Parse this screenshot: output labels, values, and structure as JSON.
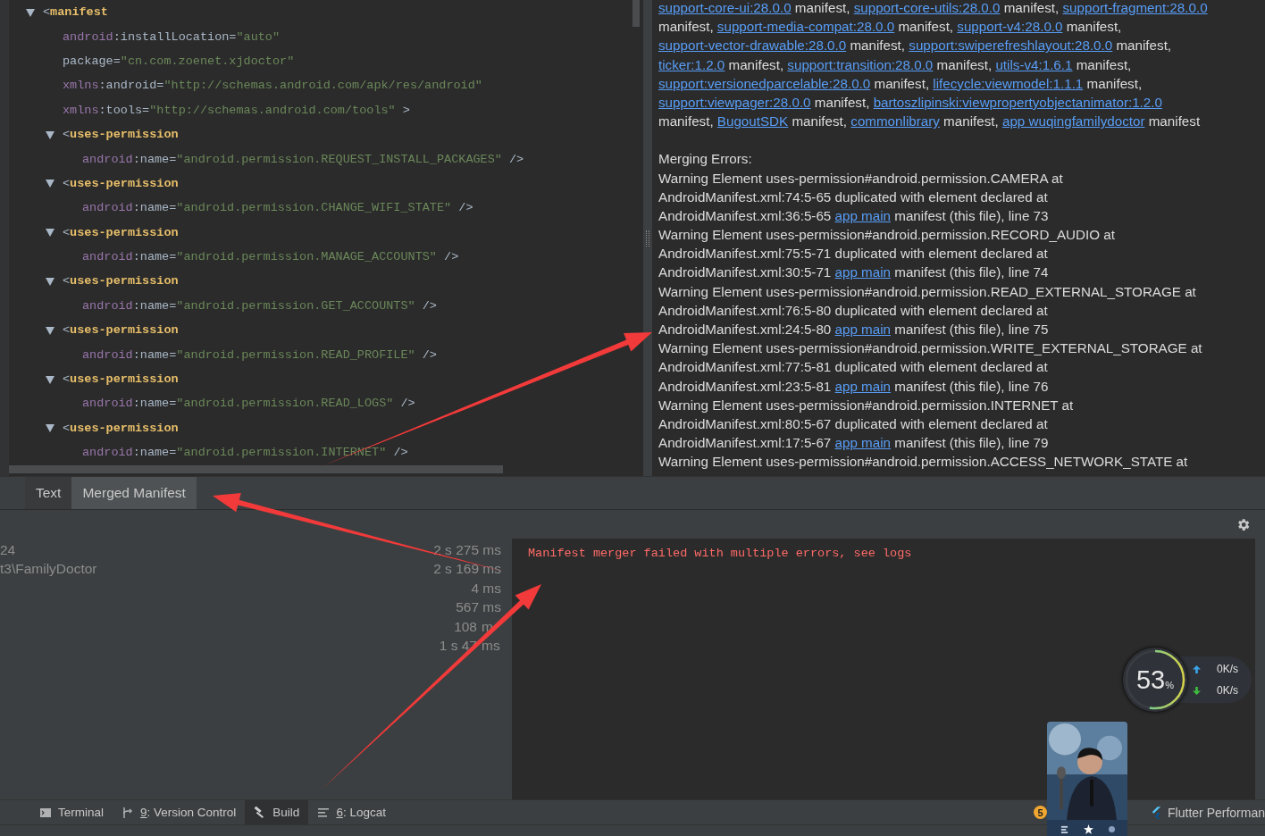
{
  "editor": {
    "nodes": [
      {
        "bracket": "<",
        "tag": "manifest",
        "expanded": true,
        "attributes": [
          {
            "prefix": "android",
            "name": ":installLocation=",
            "value": "\"auto\""
          },
          {
            "name": "package=",
            "value": "\"cn.com.zoenet.xjdoctor\""
          },
          {
            "prefix": "xmlns",
            "name": ":android=",
            "value": "\"http://schemas.android.com/apk/res/android\""
          },
          {
            "prefix": "xmlns",
            "name": ":tools=",
            "value": "\"http://schemas.android.com/tools\"",
            "suffix": " >"
          }
        ],
        "children": [
          {
            "bracket": "<",
            "tag": "uses-permission",
            "expanded": true,
            "attributes": [
              {
                "prefix": "android",
                "name": ":name=",
                "value": "\"android.permission.REQUEST_INSTALL_PACKAGES\"",
                "suffix": " />"
              }
            ]
          },
          {
            "bracket": "<",
            "tag": "uses-permission",
            "expanded": true,
            "attributes": [
              {
                "prefix": "android",
                "name": ":name=",
                "value": "\"android.permission.CHANGE_WIFI_STATE\"",
                "suffix": " />"
              }
            ]
          },
          {
            "bracket": "<",
            "tag": "uses-permission",
            "expanded": true,
            "attributes": [
              {
                "prefix": "android",
                "name": ":name=",
                "value": "\"android.permission.MANAGE_ACCOUNTS\"",
                "suffix": " />"
              }
            ]
          },
          {
            "bracket": "<",
            "tag": "uses-permission",
            "expanded": true,
            "attributes": [
              {
                "prefix": "android",
                "name": ":name=",
                "value": "\"android.permission.GET_ACCOUNTS\"",
                "suffix": " />"
              }
            ]
          },
          {
            "bracket": "<",
            "tag": "uses-permission",
            "expanded": true,
            "attributes": [
              {
                "prefix": "android",
                "name": ":name=",
                "value": "\"android.permission.READ_PROFILE\"",
                "suffix": " />"
              }
            ]
          },
          {
            "bracket": "<",
            "tag": "uses-permission",
            "expanded": true,
            "attributes": [
              {
                "prefix": "android",
                "name": ":name=",
                "value": "\"android.permission.READ_LOGS\"",
                "suffix": " />"
              }
            ]
          },
          {
            "bracket": "<",
            "tag": "uses-permission",
            "expanded": true,
            "attributes": [
              {
                "prefix": "android",
                "name": ":name=",
                "value": "\"android.permission.INTERNET\"",
                "suffix": " />"
              }
            ]
          }
        ]
      }
    ]
  },
  "merged_manifest": {
    "sources": [
      [
        {
          "text": "support-core-ui:28.0.0",
          "kind": "link"
        },
        {
          "text": " manifest, ",
          "kind": "text"
        },
        {
          "text": "support-core-utils:28.0.0",
          "kind": "link"
        },
        {
          "text": " manifest, ",
          "kind": "text"
        },
        {
          "text": "support-fragment:28.0.0",
          "kind": "link"
        }
      ],
      [
        {
          "text": "manifest, ",
          "kind": "text"
        },
        {
          "text": "support-media-compat:28.0.0",
          "kind": "link"
        },
        {
          "text": " manifest, ",
          "kind": "text"
        },
        {
          "text": "support-v4:28.0.0",
          "kind": "link"
        },
        {
          "text": " manifest,",
          "kind": "text"
        }
      ],
      [
        {
          "text": "support-vector-drawable:28.0.0",
          "kind": "link"
        },
        {
          "text": " manifest, ",
          "kind": "text"
        },
        {
          "text": "support:swiperefreshlayout:28.0.0",
          "kind": "link"
        },
        {
          "text": " manifest,",
          "kind": "text"
        }
      ],
      [
        {
          "text": "ticker:1.2.0",
          "kind": "link"
        },
        {
          "text": " manifest, ",
          "kind": "text"
        },
        {
          "text": "support:transition:28.0.0",
          "kind": "link"
        },
        {
          "text": " manifest, ",
          "kind": "text"
        },
        {
          "text": "utils-v4:1.6.1",
          "kind": "link"
        },
        {
          "text": " manifest,",
          "kind": "text"
        }
      ],
      [
        {
          "text": "support:versionedparcelable:28.0.0",
          "kind": "link"
        },
        {
          "text": " manifest, ",
          "kind": "text"
        },
        {
          "text": "lifecycle:viewmodel:1.1.1",
          "kind": "link"
        },
        {
          "text": " manifest,",
          "kind": "text"
        }
      ],
      [
        {
          "text": "support:viewpager:28.0.0",
          "kind": "link"
        },
        {
          "text": " manifest, ",
          "kind": "text"
        },
        {
          "text": "bartoszlipinski:viewpropertyobjectanimator:1.2.0",
          "kind": "link"
        }
      ],
      [
        {
          "text": "manifest, ",
          "kind": "text"
        },
        {
          "text": "BugoutSDK",
          "kind": "link"
        },
        {
          "text": " manifest, ",
          "kind": "text"
        },
        {
          "text": "commonlibrary",
          "kind": "link"
        },
        {
          "text": " manifest, ",
          "kind": "text"
        },
        {
          "text": "app wuqingfamilydoctor",
          "kind": "link"
        },
        {
          "text": " manifest",
          "kind": "text"
        }
      ]
    ],
    "errors_title": "Merging Errors:",
    "errors": [
      [
        {
          "text": "Warning Element uses-permission#android.permission.CAMERA at",
          "kind": "text"
        }
      ],
      [
        {
          "text": "AndroidManifest.xml:74:5-65 duplicated with element declared at",
          "kind": "text"
        }
      ],
      [
        {
          "text": "AndroidManifest.xml:36:5-65 ",
          "kind": "text"
        },
        {
          "text": "app main",
          "kind": "link"
        },
        {
          "text": " manifest (this file), line 73",
          "kind": "text"
        }
      ],
      [
        {
          "text": "Warning Element uses-permission#android.permission.RECORD_AUDIO at",
          "kind": "text"
        }
      ],
      [
        {
          "text": "AndroidManifest.xml:75:5-71 duplicated with element declared at",
          "kind": "text"
        }
      ],
      [
        {
          "text": "AndroidManifest.xml:30:5-71 ",
          "kind": "text"
        },
        {
          "text": "app main",
          "kind": "link"
        },
        {
          "text": " manifest (this file), line 74",
          "kind": "text"
        }
      ],
      [
        {
          "text": "Warning Element uses-permission#android.permission.READ_EXTERNAL_STORAGE at",
          "kind": "text"
        }
      ],
      [
        {
          "text": "AndroidManifest.xml:76:5-80 duplicated with element declared at",
          "kind": "text"
        }
      ],
      [
        {
          "text": "AndroidManifest.xml:24:5-80 ",
          "kind": "text"
        },
        {
          "text": "app main",
          "kind": "link"
        },
        {
          "text": " manifest (this file), line 75",
          "kind": "text"
        }
      ],
      [
        {
          "text": "Warning Element uses-permission#android.permission.WRITE_EXTERNAL_STORAGE at",
          "kind": "text"
        }
      ],
      [
        {
          "text": "AndroidManifest.xml:77:5-81 duplicated with element declared at",
          "kind": "text"
        }
      ],
      [
        {
          "text": "AndroidManifest.xml:23:5-81 ",
          "kind": "text"
        },
        {
          "text": "app main",
          "kind": "link"
        },
        {
          "text": " manifest (this file), line 76",
          "kind": "text"
        }
      ],
      [
        {
          "text": "Warning Element uses-permission#android.permission.INTERNET at",
          "kind": "text"
        }
      ],
      [
        {
          "text": "AndroidManifest.xml:80:5-67 duplicated with element declared at",
          "kind": "text"
        }
      ],
      [
        {
          "text": "AndroidManifest.xml:17:5-67 ",
          "kind": "text"
        },
        {
          "text": "app main",
          "kind": "link"
        },
        {
          "text": " manifest (this file), line 79",
          "kind": "text"
        }
      ],
      [
        {
          "text": "Warning Element uses-permission#android.permission.ACCESS_NETWORK_STATE at",
          "kind": "text"
        }
      ]
    ]
  },
  "editor_tabs": [
    {
      "label": "Text",
      "selected": false
    },
    {
      "label": "Merged Manifest",
      "selected": true
    }
  ],
  "build": {
    "rows": [
      {
        "label": "24",
        "time": "2 s 275 ms"
      },
      {
        "label": "t3\\FamilyDoctor",
        "time": "2 s 169 ms"
      },
      {
        "time": "4 ms"
      },
      {
        "time": "567 ms"
      },
      {
        "time": "108",
        "time_end": "m"
      },
      {
        "time": "1 s 47",
        "time_end": "ms"
      }
    ],
    "console": "Manifest merger failed with multiple errors, see logs"
  },
  "tool_windows": [
    {
      "kind": "terminal",
      "label": "Terminal",
      "selected": false
    },
    {
      "kind": "vcs",
      "mnemonic": "9",
      "label": ": Version Control",
      "selected": false
    },
    {
      "kind": "build",
      "label": "Build",
      "selected": true
    },
    {
      "kind": "logcat",
      "mnemonic": "6",
      "label": ": Logcat",
      "selected": false
    }
  ],
  "event_badge": "5",
  "flutter_tab": "Flutter Performan",
  "speed_meter": {
    "percent": "53",
    "unit": "%",
    "upload": "0K/s",
    "download": "0K/s"
  },
  "annotations": [
    {
      "kind": "arrow"
    },
    {
      "kind": "arrow"
    },
    {
      "kind": "arrow"
    }
  ]
}
